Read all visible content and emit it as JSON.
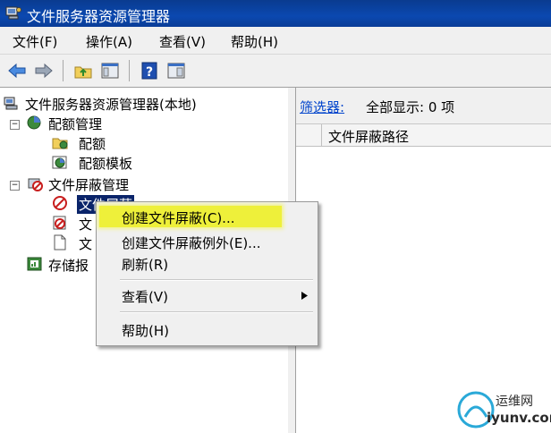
{
  "window": {
    "title": "文件服务器资源管理器"
  },
  "menubar": {
    "items": [
      "文件(F)",
      "操作(A)",
      "查看(V)",
      "帮助(H)"
    ]
  },
  "toolbar": {
    "icons": [
      "back-icon",
      "forward-icon",
      "up-folder-icon",
      "show-hide-tree-icon",
      "help-icon",
      "action-pane-icon"
    ]
  },
  "tree": {
    "root": "文件服务器资源管理器(本地)",
    "quota": {
      "label": "配额管理",
      "children": [
        "配额",
        "配额模板"
      ]
    },
    "screen": {
      "label": "文件屏蔽管理",
      "children": [
        "文件屏蔽",
        "文",
        "文"
      ]
    },
    "storage": "存储报"
  },
  "right": {
    "filter_label": "筛选器:",
    "filter_status": "全部显示: 0 项",
    "column_header": "文件屏蔽路径"
  },
  "context_menu": {
    "items": [
      "创建文件屏蔽(C)...",
      "创建文件屏蔽例外(E)...",
      "刷新(R)",
      "查看(V)",
      "帮助(H)"
    ],
    "highlight_color": "#eef03a"
  },
  "watermark": {
    "brand": "运维网",
    "domain": "iyunv.com"
  },
  "colors": {
    "title_bar": "#0b48b0",
    "link": "#0044cc",
    "selection": "#0a246a"
  }
}
